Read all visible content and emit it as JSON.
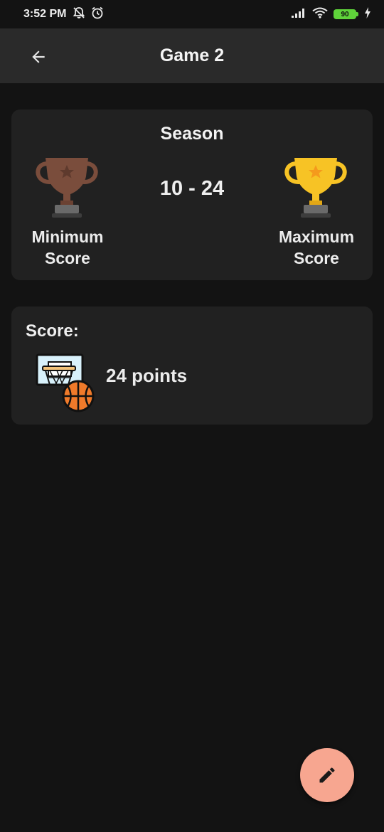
{
  "status_bar": {
    "time": "3:52 PM",
    "battery": "90",
    "icons": [
      "mute-notifications-icon",
      "alarm-icon",
      "signal-icon",
      "wifi-icon",
      "battery-icon",
      "charging-icon"
    ]
  },
  "app_bar": {
    "title": "Game 2",
    "back_icon": "arrow-back-icon"
  },
  "season_card": {
    "title": "Season",
    "range": "10 - 24",
    "min_label": "Minimum\nScore",
    "max_label": "Maximum\nScore",
    "min_trophy_color": "#7a4d3c",
    "max_trophy_color": "#f7c325"
  },
  "score_card": {
    "heading": "Score:",
    "points": "24 points",
    "icon": "basketball-hoop-icon"
  },
  "fab": {
    "icon": "edit-pencil-icon",
    "color": "#f7a690"
  }
}
